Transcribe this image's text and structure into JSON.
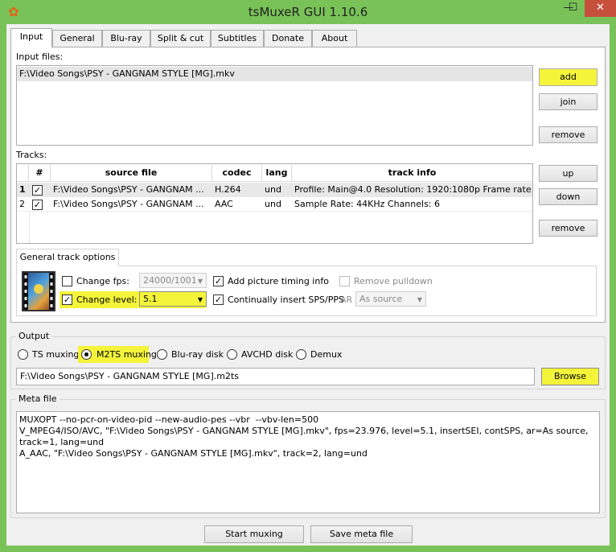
{
  "window": {
    "title": "tsMuxeR GUI 1.10.6",
    "app_icon": "tsmuxer-gear-icon",
    "minimize_glyph": "—",
    "maximize_glyph": "☐",
    "close_glyph": "✕"
  },
  "tabs": [
    {
      "label": "Input",
      "active": true
    },
    {
      "label": "General",
      "active": false
    },
    {
      "label": "Blu-ray",
      "active": false
    },
    {
      "label": "Split & cut",
      "active": false
    },
    {
      "label": "Subtitles",
      "active": false
    },
    {
      "label": "Donate",
      "active": false
    },
    {
      "label": "About",
      "active": false
    }
  ],
  "input_files": {
    "label": "Input files:",
    "items": [
      "F:\\Video Songs\\PSY - GANGNAM STYLE [MG].mkv"
    ],
    "buttons": {
      "add": "add",
      "join": "join",
      "remove": "remove"
    }
  },
  "tracks": {
    "label": "Tracks:",
    "columns": {
      "num": "#",
      "source": "source file",
      "codec": "codec",
      "lang": "lang",
      "info": "track info"
    },
    "rows": [
      {
        "index": "1",
        "checked": true,
        "source": "F:\\Video Songs\\PSY - GANGNAM ...",
        "codec": "H.264",
        "lang": "und",
        "info": "Profile: Main@4.0  Resolution: 1920:1080p  Frame rate..."
      },
      {
        "index": "2",
        "checked": true,
        "source": "F:\\Video Songs\\PSY - GANGNAM ...",
        "codec": "AAC",
        "lang": "und",
        "info": "Sample Rate: 44KHz  Channels: 6"
      }
    ],
    "buttons": {
      "up": "up",
      "down": "down",
      "remove": "remove"
    }
  },
  "track_options": {
    "tab_label": "General track options",
    "change_fps": {
      "label": "Change fps:",
      "checked": false,
      "value": "24000/1001"
    },
    "change_level": {
      "label": "Change level:",
      "checked": true,
      "value": "5.1"
    },
    "picture_timing": {
      "label": "Add picture timing info",
      "checked": true
    },
    "insert_sps": {
      "label": "Continually insert SPS/PPS",
      "checked": true
    },
    "remove_pulldown": {
      "label": "Remove pulldown",
      "checked": false
    },
    "ar": {
      "label": "AR",
      "value": "As source"
    }
  },
  "output": {
    "label": "Output",
    "modes": [
      {
        "label": "TS muxing",
        "selected": false
      },
      {
        "label": "M2TS muxing",
        "selected": true
      },
      {
        "label": "Blu-ray disk",
        "selected": false
      },
      {
        "label": "AVCHD disk",
        "selected": false
      },
      {
        "label": "Demux",
        "selected": false
      }
    ],
    "path": "F:\\Video Songs\\PSY - GANGNAM STYLE [MG].m2ts",
    "browse": "Browse"
  },
  "meta": {
    "label": "Meta file",
    "text": "MUXOPT --no-pcr-on-video-pid --new-audio-pes --vbr  --vbv-len=500\nV_MPEG4/ISO/AVC, \"F:\\Video Songs\\PSY - GANGNAM STYLE [MG].mkv\", fps=23.976, level=5.1, insertSEI, contSPS, ar=As source, track=1, lang=und\nA_AAC, \"F:\\Video Songs\\PSY - GANGNAM STYLE [MG].mkv\", track=2, lang=und"
  },
  "actions": {
    "start": "Start muxing",
    "save": "Save meta file"
  },
  "colors": {
    "highlight": "#f4f43a",
    "titlebar": "#78c257",
    "close": "#c7503d"
  }
}
